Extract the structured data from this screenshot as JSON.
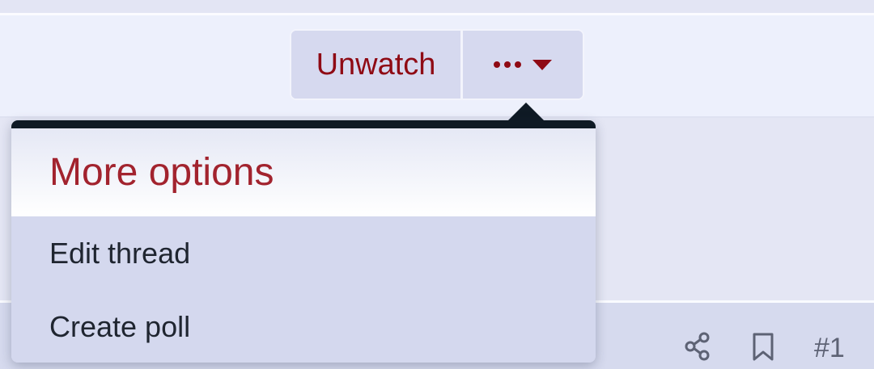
{
  "thread_actions": {
    "unwatch_label": "Unwatch",
    "more_icon": "ellipsis-icon",
    "caret_icon": "caret-down-icon"
  },
  "more_menu": {
    "title": "More options",
    "items": [
      {
        "label": "Edit thread"
      },
      {
        "label": "Create poll"
      }
    ]
  },
  "post_footer": {
    "share_icon": "share-icon",
    "bookmark_icon": "bookmark-icon",
    "post_number": "#1"
  },
  "colors": {
    "accent": "#8f0a14",
    "menu_title": "#a2232e",
    "menu_bar": "#0f1a25",
    "button_bg": "#d6d9ef",
    "header_bg": "#edf0fc",
    "footer_bg": "#d6daee"
  }
}
